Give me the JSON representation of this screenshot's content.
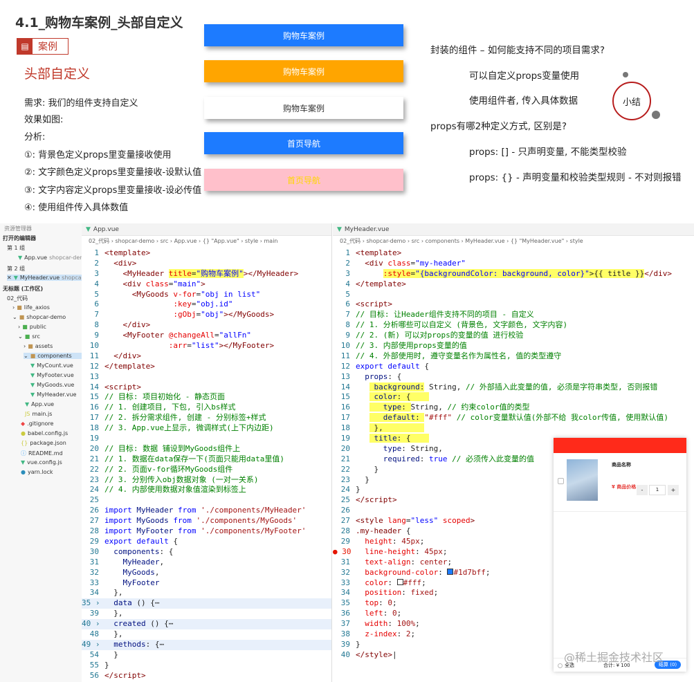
{
  "slide": {
    "section_title": "4.1_购物车案例_头部自定义",
    "tag_label": "案例",
    "tag_icon": "document-icon",
    "heading": "头部自定义",
    "left_lines": [
      "需求: 我们的组件支持自定义",
      "效果如图:",
      "分析:",
      "①: 背景色定义props里变量接收使用",
      "②: 文字颜色定义props里变量接收-设默认值",
      "③: 文字内容定义props里变量接收-设必传值",
      "④: 使用组件传入具体数值"
    ],
    "demo_headers": [
      {
        "text": "购物车案例",
        "bg": "#1d7bff",
        "color": "#ffffff"
      },
      {
        "text": "购物车案例",
        "bg": "#ffa500",
        "color": "#ffffff"
      },
      {
        "text": "购物车案例",
        "bg": "#ffffff",
        "color": "#333333"
      },
      {
        "text": "首页导航",
        "bg": "#1d7bff",
        "color": "#ffffff"
      },
      {
        "text": "首页导航",
        "bg": "#ffc0cb",
        "color": "#ffd700"
      }
    ],
    "right_lines": [
      "封装的组件 – 如何能支持不同的项目需求?",
      "可以自定义props变量使用",
      "使用组件者, 传入具体数据",
      "props有哪2种定义方式, 区别是?",
      "props: [] - 只声明变量, 不能类型校验",
      "props: {} - 声明变量和校验类型规则 - 不对则报错"
    ],
    "summary_label": "小结"
  },
  "sidebar": {
    "items": [
      "资源管理器",
      "打开的编辑器",
      "第 1 组",
      "App.vue",
      "shopcar-demo",
      "第 2 组",
      "MyHeader.vue",
      "shopcar...",
      "无标题 (工作区)",
      "02_代码",
      "life_axios",
      "shopcar-demo",
      "public",
      "src",
      "assets",
      "components",
      "MyCount.vue",
      "MyFooter.vue",
      "MyGoods.vue",
      "MyHeader.vue",
      "App.vue",
      "main.js",
      ".gitignore",
      "babel.config.js",
      "package.json",
      "README.md",
      "vue.config.js",
      "yarn.lock"
    ]
  },
  "editor_left": {
    "tab": "App.vue",
    "crumb": "02_代码 › shopcar-demo › src › App.vue › {} \"App.vue\" › style › main",
    "gutter": "⊞"
  },
  "editor_right": {
    "tab": "MyHeader.vue",
    "crumb": "02_代码 › shopcar-demo › src › components › MyHeader.vue › {} \"MyHeader.vue\" › style"
  },
  "cart_preview": {
    "product_name": "商品名称",
    "price": "¥ 商品价格",
    "qty_minus": "-",
    "qty": "1",
    "qty_plus": "+",
    "select_all": "全选",
    "total": "合计: ¥ 100",
    "checkout": "结算 (0)"
  },
  "watermark": "@稀土掘金技术社区"
}
